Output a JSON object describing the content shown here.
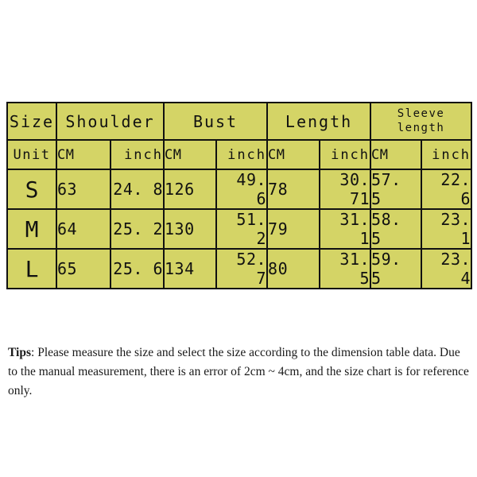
{
  "table": {
    "corner_size_label": "Size",
    "corner_unit_label": "Unit",
    "groups": [
      {
        "label": "Shoulder",
        "two_line": false
      },
      {
        "label": "Bust",
        "two_line": false
      },
      {
        "label": "Length",
        "two_line": false
      },
      {
        "label_line1": "Sleeve",
        "label_line2": "length",
        "two_line": true
      }
    ],
    "units": {
      "cm": "CM",
      "inch": "inch"
    },
    "rows": [
      {
        "size": "S",
        "shoulder_cm": "63",
        "shoulder_in": "24. 8",
        "bust_cm": "126",
        "bust_in": "49. 6",
        "length_cm": "78",
        "length_in": "30. 71",
        "sleeve_cm": "57. 5",
        "sleeve_in": "22. 6"
      },
      {
        "size": "M",
        "shoulder_cm": "64",
        "shoulder_in": "25. 2",
        "bust_cm": "130",
        "bust_in": "51. 2",
        "length_cm": "79",
        "length_in": "31. 1",
        "sleeve_cm": "58. 5",
        "sleeve_in": "23. 1"
      },
      {
        "size": "L",
        "shoulder_cm": "65",
        "shoulder_in": "25. 6",
        "bust_cm": "134",
        "bust_in": "52. 7",
        "length_cm": "80",
        "length_in": "31. 5",
        "sleeve_cm": "59. 5",
        "sleeve_in": "23. 4"
      }
    ]
  },
  "tips": {
    "label": "Tips",
    "body": ": Please measure the size and select the size according to the dimension table data. Due to the manual measurement, there is an error of 2cm ~ 4cm, and the size chart is for reference only."
  },
  "colors": {
    "cell_background": "#d4d466",
    "border": "#111111",
    "page_background": "#ffffff",
    "text": "#111111"
  },
  "chart_data": {
    "type": "table",
    "title": "Size chart",
    "categories": [
      "S",
      "M",
      "L"
    ],
    "columns": [
      "Size",
      "Shoulder CM",
      "Shoulder inch",
      "Bust CM",
      "Bust inch",
      "Length CM",
      "Length inch",
      "Sleeve length CM",
      "Sleeve length inch"
    ],
    "series": [
      {
        "name": "Shoulder CM",
        "values": [
          63,
          64,
          65
        ]
      },
      {
        "name": "Shoulder inch",
        "values": [
          24.8,
          25.2,
          25.6
        ]
      },
      {
        "name": "Bust CM",
        "values": [
          126,
          130,
          134
        ]
      },
      {
        "name": "Bust inch",
        "values": [
          49.6,
          51.2,
          52.7
        ]
      },
      {
        "name": "Length CM",
        "values": [
          78,
          79,
          80
        ]
      },
      {
        "name": "Length inch",
        "values": [
          30.71,
          31.1,
          31.5
        ]
      },
      {
        "name": "Sleeve length CM",
        "values": [
          57.5,
          58.5,
          59.5
        ]
      },
      {
        "name": "Sleeve length inch",
        "values": [
          22.6,
          23.1,
          23.4
        ]
      }
    ]
  }
}
